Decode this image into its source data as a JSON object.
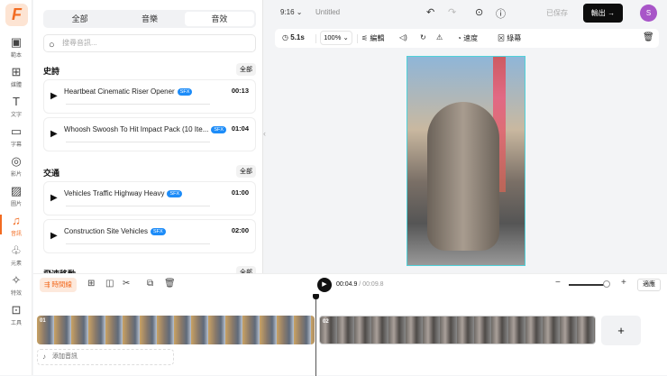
{
  "rail": {
    "items": [
      {
        "label": "範本",
        "icon": "template-icon"
      },
      {
        "label": "媒體",
        "icon": "media-icon"
      },
      {
        "label": "文字",
        "icon": "text-icon"
      },
      {
        "label": "字幕",
        "icon": "subtitle-icon"
      },
      {
        "label": "影片",
        "icon": "video-icon"
      },
      {
        "label": "圖片",
        "icon": "image-icon"
      },
      {
        "label": "音訊",
        "icon": "music-icon"
      },
      {
        "label": "元素",
        "icon": "elements-icon"
      },
      {
        "label": "特效",
        "icon": "effects-icon"
      },
      {
        "label": "工具",
        "icon": "tools-icon"
      }
    ]
  },
  "panel": {
    "tabs": [
      "全部",
      "音樂",
      "音效"
    ],
    "search_placeholder": "搜尋音訊...",
    "sections": [
      {
        "title": "史詩",
        "all": "全部",
        "items": [
          {
            "title": "Heartbeat Cinematic Riser Opener",
            "badge": "SFX",
            "duration": "00:13"
          },
          {
            "title": "Whoosh Swoosh To Hit Impact Pack (10 Ite...",
            "badge": "SFX",
            "duration": "01:04"
          }
        ]
      },
      {
        "title": "交通",
        "all": "全部",
        "items": [
          {
            "title": "Vehicles Traffic Highway Heavy",
            "badge": "SFX",
            "duration": "01:00"
          },
          {
            "title": "Construction Site Vehicles",
            "badge": "SFX",
            "duration": "02:00"
          }
        ]
      },
      {
        "title": "飛速移動",
        "all": "全部",
        "items": []
      }
    ]
  },
  "topbar": {
    "ratio": "9:16",
    "title": "Untitled",
    "saved": "已保存",
    "export": "輸出 →",
    "avatar": "S"
  },
  "toolbar": {
    "duration": "5.1s",
    "zoom": "100%",
    "edit": "編輯",
    "speed": "速度",
    "greenscreen": "綠幕"
  },
  "timeline": {
    "chip": "時間線",
    "current": "00:04.9",
    "total": " / 00:09.8",
    "fit": "適應",
    "clips": [
      "01",
      "02"
    ],
    "add_clip": "+",
    "add_audio": "添加音訊",
    "zoom_level": 0.9
  },
  "colors": {
    "accent": "#f26b21",
    "sfx": "#1d8cf8"
  }
}
